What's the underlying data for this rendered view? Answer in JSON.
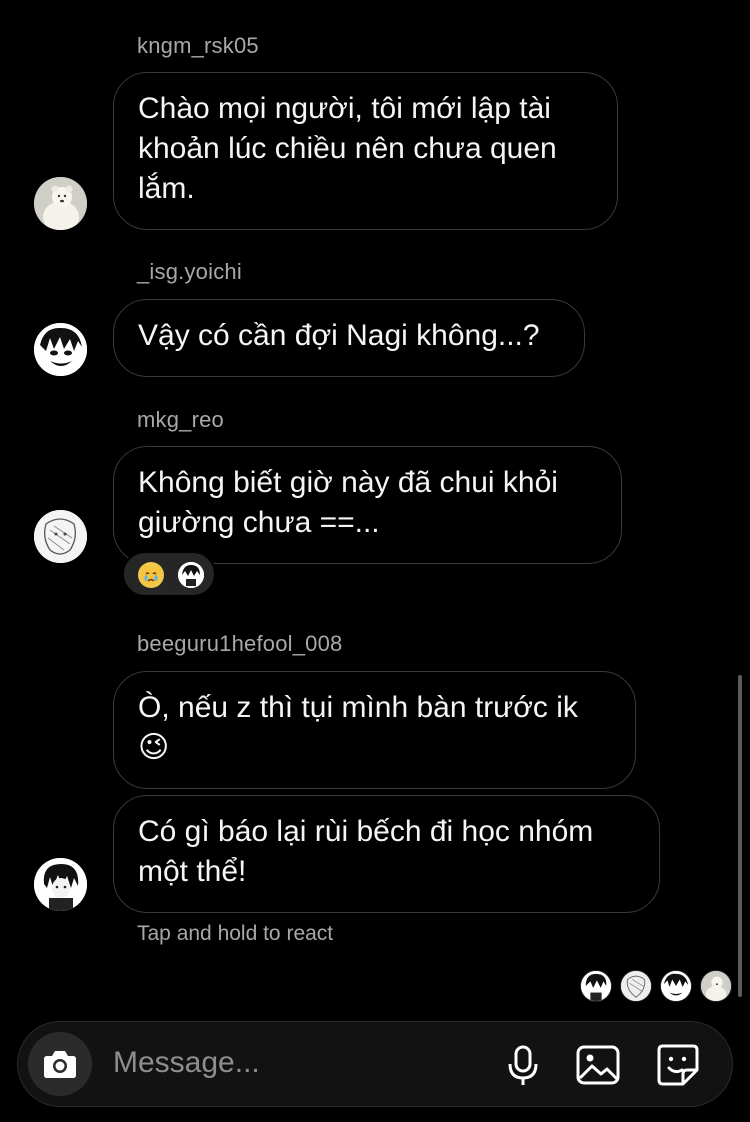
{
  "messages": [
    {
      "username": "kngm_rsk05",
      "lines": [
        "Chào mọi người, tôi mới lập tài",
        "khoản lúc chiều nên chưa quen",
        "lắm."
      ]
    },
    {
      "username": "_isg.yoichi",
      "lines": [
        "Vậy có cần đợi Nagi không...?"
      ]
    },
    {
      "username": "mkg_reo",
      "lines": [
        "Không biết giờ này đã chui khỏi",
        "giường chưa ==..."
      ]
    },
    {
      "username": "beeguru1hefool_008",
      "lines": [
        "Ò, nếu z thì tụi mình bàn trước ik",
        "😉"
      ],
      "lines2": [
        "Có gì báo lại rùi bếch đi học nhóm",
        "một thể!"
      ]
    }
  ],
  "reactions": [
    "crying-cat-emoji",
    "avatar"
  ],
  "hint": "Tap and hold to react",
  "composer": {
    "placeholder": "Message..."
  },
  "colors": {
    "background": "#000000",
    "bubble_border": "#3a3a3a",
    "muted_text": "#a8a8a8"
  }
}
